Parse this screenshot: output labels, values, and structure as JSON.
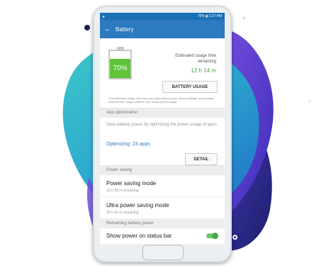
{
  "status_bar": {
    "left_icon": "play-notification-icon",
    "right_text": "70% ▮ 1:27 PM"
  },
  "app_bar": {
    "back_icon": "arrow-left-icon",
    "title": "Battery"
  },
  "battery_card": {
    "percent_label": "70%",
    "level_fraction": 0.7,
    "estimated_label": "Estimated usage time remaining",
    "estimated_value": "12 h 14 m",
    "usage_button_label": "BATTERY USAGE",
    "disclaimer": "The estimated usage time may vary depending on your device settings, surrounding environment, usage patterns, and actual device usage."
  },
  "app_optimization": {
    "header": "App optimization",
    "description": "Save battery power by optimizing the power usage of apps.",
    "link_label": "Optimizing: 23 apps",
    "detail_button_label": "DETAIL"
  },
  "power_saving": {
    "header": "Power saving",
    "items": [
      {
        "title": "Power saving mode",
        "subtitle": "12 h 58 m remaining"
      },
      {
        "title": "Ultra power saving mode",
        "subtitle": "38 h 44 m remaining"
      }
    ]
  },
  "remaining_power": {
    "header": "Remaining battery power",
    "toggle_label": "Show power on status bar",
    "toggle_on": true
  },
  "colors": {
    "accent_blue": "#2d7ac0",
    "battery_green": "#5fc43a",
    "blob_teal": "#2fb6c9",
    "blob_purple": "#5b3fd1"
  }
}
